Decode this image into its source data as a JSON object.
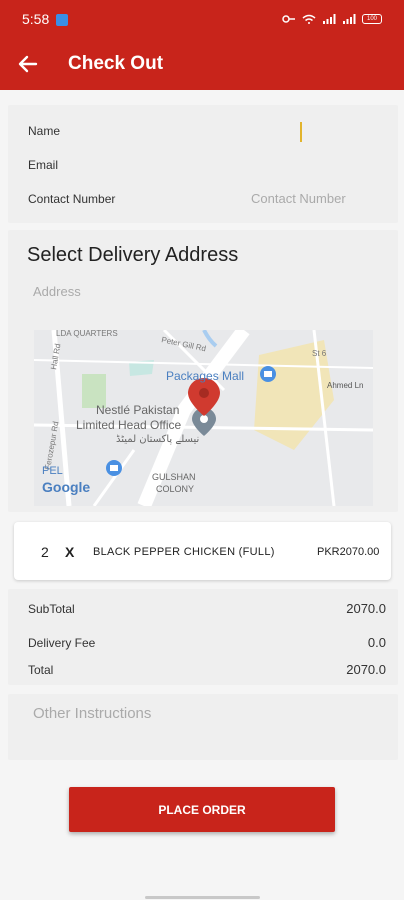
{
  "status": {
    "time": "5:58",
    "battery": "100"
  },
  "header": {
    "title": "Check Out"
  },
  "contact": {
    "name_label": "Name",
    "email_label": "Email",
    "contact_label": "Contact Number",
    "contact_placeholder": "Contact Number"
  },
  "delivery": {
    "title": "Select Delivery Address",
    "address_placeholder": "Address",
    "map_labels": {
      "packages_mall": "Packages Mall",
      "nestle_line1": "Nestlé Pakistan",
      "nestle_line2": "Limited Head Office",
      "nestle_urdu": "نیسلے پاکستان لمیٹڈ",
      "pel": "PEL",
      "google": "Google",
      "gulshan1": "GULSHAN",
      "gulshan2": "COLONY",
      "lda": "LDA QUARTERS",
      "peter_gill": "Peter Gill Rd",
      "ferozepur": "Ferozepur Rd",
      "hall_rd": "Hall Rd",
      "st6": "St 6",
      "ahmed_ln": "Ahmed Ln"
    }
  },
  "order": {
    "quantity": "2",
    "times": "X",
    "item": "BLACK PEPPER CHICKEN (FULL)",
    "price": "PKR2070.00"
  },
  "totals": {
    "subtotal_label": "SubTotal",
    "subtotal_value": "2070.0",
    "delivery_label": "Delivery Fee",
    "delivery_value": "0.0",
    "total_label": "Total",
    "total_value": "2070.0"
  },
  "instructions": {
    "placeholder": "Other Instructions"
  },
  "actions": {
    "place_order": "PLACE ORDER"
  },
  "colors": {
    "primary": "#c8241b",
    "cursor": "#e2b42d"
  }
}
